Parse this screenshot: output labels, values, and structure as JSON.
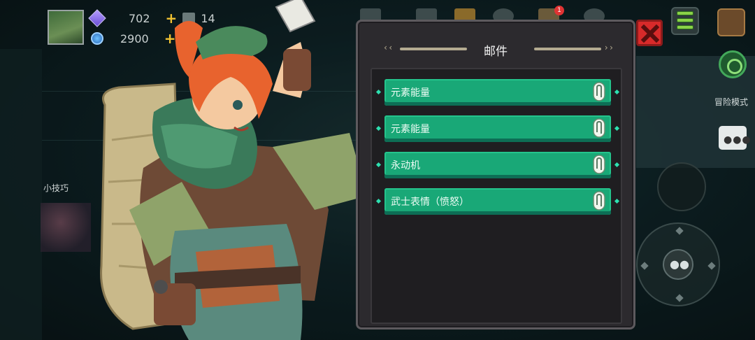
{
  "hud": {
    "gems": "702",
    "coins": "2900",
    "materials": "14",
    "gem_icon": "gem-icon",
    "coin_icon": "coin-icon"
  },
  "hint": {
    "label": "小技巧"
  },
  "mail": {
    "title": "邮件",
    "items": [
      {
        "label": "元素能量",
        "icon": "attachment-clip-icon"
      },
      {
        "label": "元素能量",
        "icon": "attachment-clip-icon"
      },
      {
        "label": "永动机",
        "icon": "attachment-clip-icon"
      },
      {
        "label": "武士表情（愤怒）",
        "icon": "attachment-clip-icon"
      }
    ]
  },
  "top_right": {
    "notification_badge": "1",
    "mode_label": "冒险模式"
  },
  "colors": {
    "mail_item": "#19a877",
    "panel_bg": "#2c2a2e",
    "close_button": "#d82a2a"
  }
}
